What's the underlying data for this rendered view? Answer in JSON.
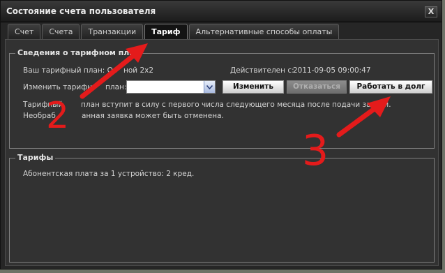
{
  "window": {
    "title": "Состояние счета пользователя",
    "close_label": "X"
  },
  "tabs": [
    {
      "label": "Счет",
      "active": false
    },
    {
      "label": "Счета",
      "active": false
    },
    {
      "label": "Транзакции",
      "active": false
    },
    {
      "label": "Тариф",
      "active": true
    },
    {
      "label": "Альтернативные способы оплаты",
      "active": false
    }
  ],
  "tariff_info": {
    "legend": "Сведения о тарифном пла",
    "current_label": "Ваш тарифный план: Ос",
    "current_value": "ной 2x2",
    "valid_label": "Действителен с:",
    "valid_value": "2011-09-05 09:00:47",
    "change_label": "Изменить тарифн",
    "change_suffix": "план:",
    "select_value": "",
    "btn_change": "Изменить",
    "btn_cancel": "Отказаться",
    "btn_debt": "Работать в долг",
    "note_line1_a": "Тарифный",
    "note_line1_b": "план вступит в силу с первого числа следующего месяца после подачи заявки.",
    "note_line2_a": "Необраб",
    "note_line2_b": "анная заявка может быть отменена."
  },
  "tariffs": {
    "legend": "Тарифы",
    "fee_text": "Абонентская плата за 1 устройство: 2 кред."
  },
  "annotations": {
    "n2": "2",
    "n3": "3",
    "arrow_color": "#e41b1b"
  }
}
